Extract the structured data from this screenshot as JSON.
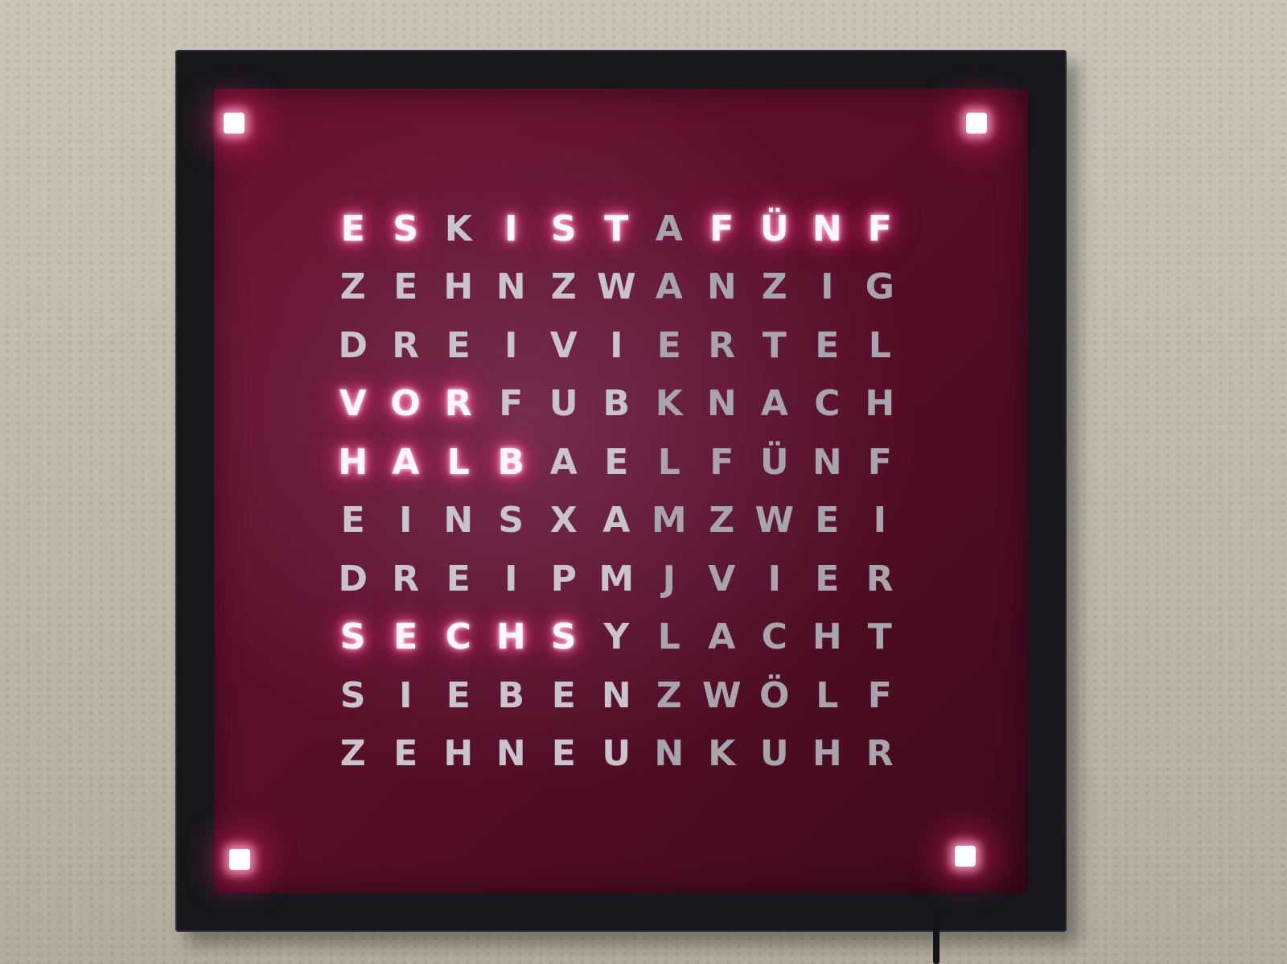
{
  "clock": {
    "rows": [
      [
        "E",
        "S",
        "K",
        "I",
        "S",
        "T",
        "A",
        "F",
        "Ü",
        "N",
        "F"
      ],
      [
        "Z",
        "E",
        "H",
        "N",
        "Z",
        "W",
        "A",
        "N",
        "Z",
        "I",
        "G"
      ],
      [
        "D",
        "R",
        "E",
        "I",
        "V",
        "I",
        "E",
        "R",
        "T",
        "E",
        "L"
      ],
      [
        "V",
        "O",
        "R",
        "F",
        "U",
        "B",
        "K",
        "N",
        "A",
        "C",
        "H"
      ],
      [
        "H",
        "A",
        "L",
        "B",
        "A",
        "E",
        "L",
        "F",
        "Ü",
        "N",
        "F"
      ],
      [
        "E",
        "I",
        "N",
        "S",
        "X",
        "A",
        "M",
        "Z",
        "W",
        "E",
        "I"
      ],
      [
        "D",
        "R",
        "E",
        "I",
        "P",
        "M",
        "J",
        "V",
        "I",
        "E",
        "R"
      ],
      [
        "S",
        "E",
        "C",
        "H",
        "S",
        "Y",
        "L",
        "A",
        "C",
        "H",
        "T"
      ],
      [
        "S",
        "I",
        "E",
        "B",
        "E",
        "N",
        "Z",
        "W",
        "Ö",
        "L",
        "F"
      ],
      [
        "Z",
        "E",
        "H",
        "N",
        "E",
        "U",
        "N",
        "K",
        "U",
        "H",
        "R"
      ]
    ],
    "lit": [
      [
        0,
        0
      ],
      [
        0,
        1
      ],
      [
        0,
        3
      ],
      [
        0,
        4
      ],
      [
        0,
        5
      ],
      [
        0,
        7
      ],
      [
        0,
        8
      ],
      [
        0,
        9
      ],
      [
        0,
        10
      ],
      [
        3,
        0
      ],
      [
        3,
        1
      ],
      [
        3,
        2
      ],
      [
        4,
        0
      ],
      [
        4,
        1
      ],
      [
        4,
        2
      ],
      [
        4,
        3
      ],
      [
        7,
        0
      ],
      [
        7,
        1
      ],
      [
        7,
        2
      ],
      [
        7,
        3
      ],
      [
        7,
        4
      ]
    ],
    "colors": {
      "panel": "#5a0e28",
      "frame": "#17171d",
      "lit_glow": "#ff2f7d",
      "unlit_letter": "#c9c4cc"
    }
  }
}
